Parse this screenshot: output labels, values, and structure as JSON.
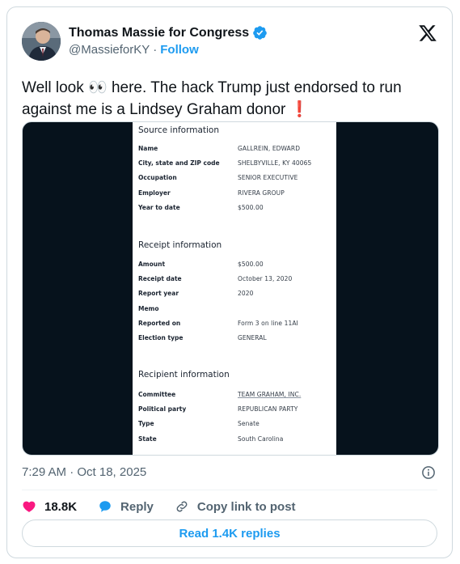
{
  "author": {
    "display_name": "Thomas Massie for Congress",
    "handle": "@MassieforKY",
    "separator": "·",
    "follow_label": "Follow",
    "verified_color": "#1d9bf0"
  },
  "tweet": {
    "text": "Well look 👀 here. The hack Trump just endorsed to run against me is a Lindsey Graham donor ❗",
    "timestamp": "7:29 AM · Oct 18, 2025"
  },
  "document": {
    "sections": [
      {
        "title": "Source information",
        "rows": [
          {
            "label": "Name",
            "value": "GALLREIN, EDWARD"
          },
          {
            "label": "City, state and ZIP code",
            "value": "SHELBYVILLE, KY 40065"
          },
          {
            "label": "Occupation",
            "value": "SENIOR EXECUTIVE"
          },
          {
            "label": "Employer",
            "value": "RIVERA GROUP"
          },
          {
            "label": "Year to date",
            "value": "$500.00"
          }
        ]
      },
      {
        "title": "Receipt information",
        "rows": [
          {
            "label": "Amount",
            "value": "$500.00"
          },
          {
            "label": "Receipt date",
            "value": "October 13, 2020"
          },
          {
            "label": "Report year",
            "value": "2020"
          },
          {
            "label": "Memo",
            "value": ""
          },
          {
            "label": "Reported on",
            "value": "Form 3 on line 11AI"
          },
          {
            "label": "Election type",
            "value": "GENERAL"
          }
        ]
      },
      {
        "title": "Recipient information",
        "rows": [
          {
            "label": "Committee",
            "value": "TEAM GRAHAM, INC."
          },
          {
            "label": "Political party",
            "value": "REPUBLICAN PARTY"
          },
          {
            "label": "Type",
            "value": "Senate"
          },
          {
            "label": "State",
            "value": "South Carolina"
          }
        ]
      }
    ]
  },
  "actions": {
    "likes": "18.8K",
    "reply_label": "Reply",
    "copy_link_label": "Copy link to post",
    "read_replies_label": "Read 1.4K replies"
  },
  "colors": {
    "accent": "#1d9bf0",
    "like": "#f91880",
    "media_bg": "#06121c"
  }
}
